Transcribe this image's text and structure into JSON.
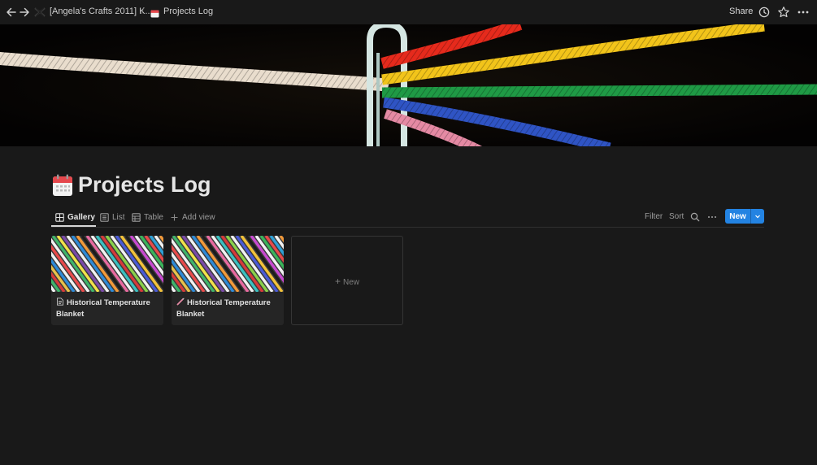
{
  "topbar": {
    "breadcrumb_workspace": "[Angela's Crafts 2011] K...",
    "breadcrumb_separator": "/",
    "breadcrumb_page": "Projects Log",
    "share_label": "Share",
    "icons": [
      "back-arrow-icon",
      "forward-arrow-icon",
      "workspace-icon",
      "calendar-icon",
      "clock-icon",
      "star-icon",
      "more-icon"
    ]
  },
  "page": {
    "title": "Projects Log",
    "title_icon": "calendar-icon"
  },
  "views": {
    "tabs": [
      {
        "label": "Gallery",
        "icon": "gallery-icon",
        "active": true
      },
      {
        "label": "List",
        "icon": "list-icon",
        "active": false
      },
      {
        "label": "Table",
        "icon": "table-icon",
        "active": false
      }
    ],
    "add_view_label": "Add view"
  },
  "toolbar": {
    "filter_label": "Filter",
    "sort_label": "Sort",
    "new_label": "New",
    "accent_color": "#2383e2"
  },
  "gallery": {
    "cards": [
      {
        "title": "Historical Temperature Blanket",
        "icon": "page-icon"
      },
      {
        "title": "Historical Temperature Blanket",
        "icon": "crochet-hook-icon"
      }
    ],
    "new_card_label": "New"
  }
}
